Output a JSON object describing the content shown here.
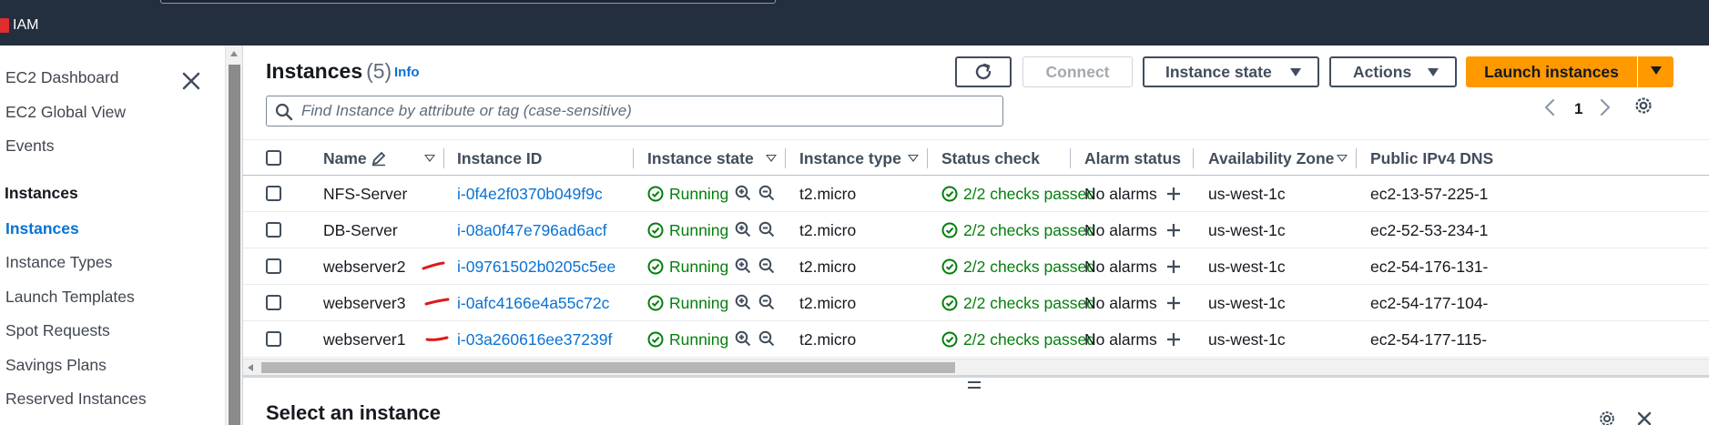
{
  "topbar": {
    "service_label": "IAM"
  },
  "sidebar": {
    "items": [
      {
        "label": "EC2 Dashboard"
      },
      {
        "label": "EC2 Global View"
      },
      {
        "label": "Events"
      },
      {
        "label": "Instances"
      },
      {
        "label": "Instances"
      },
      {
        "label": "Instance Types"
      },
      {
        "label": "Launch Templates"
      },
      {
        "label": "Spot Requests"
      },
      {
        "label": "Savings Plans"
      },
      {
        "label": "Reserved Instances"
      }
    ]
  },
  "header": {
    "title": "Instances",
    "count": "(5)",
    "info_label": "Info",
    "connect_label": "Connect",
    "instance_state_label": "Instance state",
    "actions_label": "Actions",
    "launch_label": "Launch instances"
  },
  "search": {
    "placeholder": "Find Instance by attribute or tag (case-sensitive)"
  },
  "pagination": {
    "current_page": "1"
  },
  "table": {
    "columns": [
      "Name",
      "Instance ID",
      "Instance state",
      "Instance type",
      "Status check",
      "Alarm status",
      "Availability Zone",
      "Public IPv4 DNS"
    ],
    "rows": [
      {
        "name": "NFS-Server",
        "id": "i-0f4e2f0370b049f9c",
        "state": "Running",
        "type": "t2.micro",
        "status": "2/2 checks passed",
        "alarm": "No alarms",
        "az": "us-west-1c",
        "dns": "ec2-13-57-225-1"
      },
      {
        "name": "DB-Server",
        "id": "i-08a0f47e796ad6acf",
        "state": "Running",
        "type": "t2.micro",
        "status": "2/2 checks passed",
        "alarm": "No alarms",
        "az": "us-west-1c",
        "dns": "ec2-52-53-234-1"
      },
      {
        "name": "webserver2",
        "id": "i-09761502b0205c5ee",
        "state": "Running",
        "type": "t2.micro",
        "status": "2/2 checks passed",
        "alarm": "No alarms",
        "az": "us-west-1c",
        "dns": "ec2-54-176-131-"
      },
      {
        "name": "webserver3",
        "id": "i-0afc4166e4a55c72c",
        "state": "Running",
        "type": "t2.micro",
        "status": "2/2 checks passed",
        "alarm": "No alarms",
        "az": "us-west-1c",
        "dns": "ec2-54-177-104-"
      },
      {
        "name": "webserver1",
        "id": "i-03a260616ee37239f",
        "state": "Running",
        "type": "t2.micro",
        "status": "2/2 checks passed",
        "alarm": "No alarms",
        "az": "us-west-1c",
        "dns": "ec2-54-177-115-"
      }
    ]
  },
  "bottom_panel": {
    "title": "Select an instance"
  },
  "colors": {
    "topbar": "#232f3e",
    "link": "#0972d3",
    "success": "#037f0c",
    "launch_button": "#ff9900",
    "annotation_mark": "#e0191c"
  }
}
